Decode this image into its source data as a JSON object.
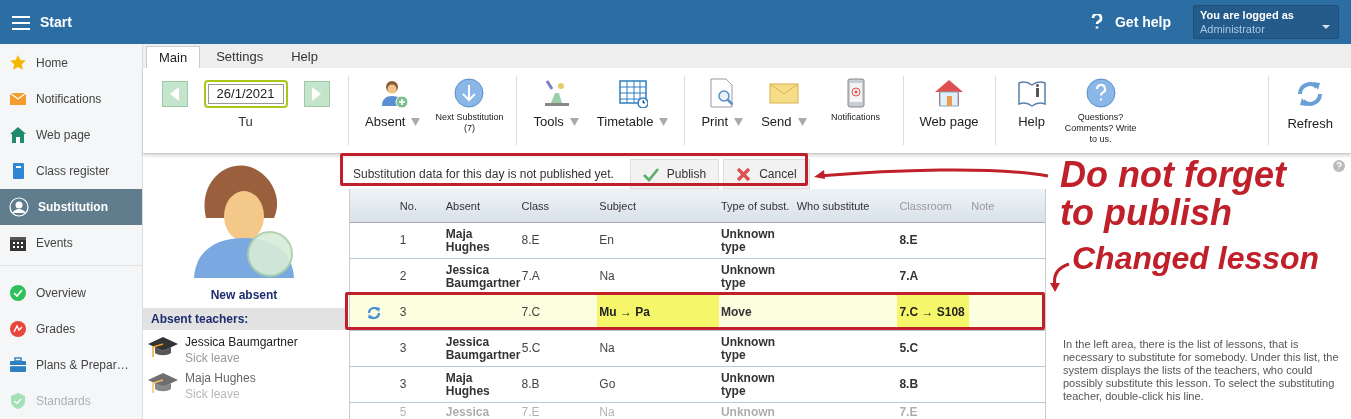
{
  "app_bar": {
    "title": "Start",
    "help": "Get help",
    "user": {
      "label": "You are logged as",
      "name": "Administrator"
    }
  },
  "sidebar": {
    "items": [
      {
        "label": "Home",
        "selected": false,
        "disabled": false
      },
      {
        "label": "Notifications",
        "selected": false,
        "disabled": false
      },
      {
        "label": "Web page",
        "selected": false,
        "disabled": false
      },
      {
        "label": "Class register",
        "selected": false,
        "disabled": false
      },
      {
        "label": "Substitution",
        "selected": true,
        "disabled": false
      },
      {
        "label": "Events",
        "selected": false,
        "disabled": false
      },
      {
        "label": "Overview",
        "selected": false,
        "disabled": false
      },
      {
        "label": "Grades",
        "selected": false,
        "disabled": false
      },
      {
        "label": "Plans & Prepar…",
        "selected": false,
        "disabled": false
      },
      {
        "label": "Standards",
        "selected": false,
        "disabled": true
      }
    ]
  },
  "tabs": [
    {
      "label": "Main",
      "selected": true
    },
    {
      "label": "Settings",
      "selected": false
    },
    {
      "label": "Help",
      "selected": false
    }
  ],
  "date": {
    "value": "26/1/2021",
    "day": "Tu"
  },
  "toolbar": {
    "groups": [
      [
        {
          "label": "Absent",
          "dropdown": true,
          "kind": "large"
        },
        {
          "label": "Next Substitution (7)",
          "dropdown": false,
          "kind": "small"
        }
      ],
      [
        {
          "label": "Tools",
          "dropdown": true,
          "kind": "large"
        },
        {
          "label": "Timetable",
          "dropdown": true,
          "kind": "large"
        }
      ],
      [
        {
          "label": "Print",
          "dropdown": true,
          "kind": "large"
        },
        {
          "label": "Send",
          "dropdown": true,
          "kind": "large"
        },
        {
          "label": "Notifications",
          "dropdown": false,
          "kind": "small"
        }
      ],
      [
        {
          "label": "Web page",
          "dropdown": false,
          "kind": "large"
        }
      ],
      [
        {
          "label": "Help",
          "dropdown": false,
          "kind": "large"
        },
        {
          "label": "Questions? Comments? Write to us.",
          "dropdown": false,
          "kind": "small"
        }
      ]
    ],
    "refresh": "Refresh"
  },
  "absent_panel": {
    "new_absent": "New absent",
    "heading": "Absent teachers:",
    "teachers": [
      {
        "name": "Jessica Baumgartner",
        "reason": "Sick leave"
      },
      {
        "name": "Maja Hughes",
        "reason": "Sick leave"
      }
    ]
  },
  "notice": {
    "text": "Substitution data for this day is not published yet.",
    "publish": "Publish",
    "cancel": "Cancel"
  },
  "table": {
    "columns": [
      "No.",
      "Absent",
      "Class",
      "Subject",
      "Type of subst.",
      "Who substitute",
      "Classroom",
      "Note"
    ],
    "rows": [
      {
        "selected": false,
        "cells": [
          "1",
          "Maja Hughes",
          "8.E",
          "En",
          "Unknown type",
          "",
          "8.E",
          ""
        ]
      },
      {
        "selected": false,
        "cells": [
          "2",
          "Jessica Baumgartner",
          "7.A",
          "Na",
          "Unknown type",
          "",
          "7.A",
          ""
        ]
      },
      {
        "selected": true,
        "cells": [
          "3",
          "",
          "7.C",
          {
            "text": "Mu → Pa",
            "highlight": true
          },
          "Move",
          "",
          {
            "text": "7.C → S108",
            "highlight": true
          },
          ""
        ]
      },
      {
        "selected": false,
        "cells": [
          "3",
          "Jessica Baumgartner",
          "5.C",
          "Na",
          "Unknown type",
          "",
          "5.C",
          ""
        ]
      },
      {
        "selected": false,
        "cells": [
          "3",
          "Maja Hughes",
          "8.B",
          "Go",
          "Unknown type",
          "",
          "8.B",
          ""
        ]
      },
      {
        "selected": false,
        "cells": [
          "5",
          "Jessica",
          "7.E",
          "Na",
          "Unknown",
          "",
          "7.E",
          ""
        ]
      }
    ]
  },
  "help_text": "In the left area, there is the list of lessons, that is necessary to substitute for somebody. Under this list, the system displays the lists of the teachers, who could possibly substitute this lesson. To select the substituting teacher, double-click his line.",
  "annotations": [
    {
      "text": "Do not forget to publish"
    },
    {
      "text": "Changed lesson"
    }
  ]
}
